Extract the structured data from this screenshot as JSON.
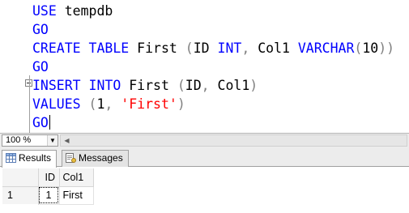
{
  "editor": {
    "lines": [
      {
        "parts": [
          {
            "t": "USE ",
            "c": "kw"
          },
          {
            "t": "tempdb",
            "c": "ident"
          }
        ]
      },
      {
        "parts": [
          {
            "t": "GO",
            "c": "kw"
          }
        ]
      },
      {
        "parts": [
          {
            "t": "CREATE ",
            "c": "kw"
          },
          {
            "t": "TABLE ",
            "c": "kw"
          },
          {
            "t": "First ",
            "c": "ident"
          },
          {
            "t": "(",
            "c": "punct"
          },
          {
            "t": "ID ",
            "c": "ident"
          },
          {
            "t": "INT",
            "c": "kw"
          },
          {
            "t": ", ",
            "c": "punct"
          },
          {
            "t": "Col1 ",
            "c": "ident"
          },
          {
            "t": "VARCHAR",
            "c": "kw"
          },
          {
            "t": "(",
            "c": "punct"
          },
          {
            "t": "10",
            "c": "num"
          },
          {
            "t": "))",
            "c": "punct"
          }
        ]
      },
      {
        "parts": [
          {
            "t": "GO",
            "c": "kw"
          }
        ]
      },
      {
        "parts": [
          {
            "t": "INSERT ",
            "c": "kw"
          },
          {
            "t": "INTO ",
            "c": "kw"
          },
          {
            "t": "First ",
            "c": "ident"
          },
          {
            "t": "(",
            "c": "punct"
          },
          {
            "t": "ID",
            "c": "ident"
          },
          {
            "t": ", ",
            "c": "punct"
          },
          {
            "t": "Col1",
            "c": "ident"
          },
          {
            "t": ")",
            "c": "punct"
          }
        ]
      },
      {
        "parts": [
          {
            "t": "VALUES ",
            "c": "kw"
          },
          {
            "t": "(",
            "c": "punct"
          },
          {
            "t": "1",
            "c": "num"
          },
          {
            "t": ", ",
            "c": "punct"
          },
          {
            "t": "'First'",
            "c": "str"
          },
          {
            "t": ")",
            "c": "punct"
          }
        ]
      },
      {
        "parts": [
          {
            "t": "GO",
            "c": "kw"
          }
        ],
        "caret": true
      }
    ],
    "colors": {
      "keyword": "#0000ff",
      "string": "#ff0000",
      "punct": "#808080"
    }
  },
  "zoom": {
    "value": "100 %",
    "arrow_icon": "chevron-down-icon"
  },
  "results_tabs": [
    {
      "label": "Results",
      "icon": "grid-icon",
      "active": true
    },
    {
      "label": "Messages",
      "icon": "messages-icon",
      "active": false
    }
  ],
  "grid": {
    "columns": [
      "ID",
      "Col1"
    ],
    "rows": [
      {
        "rownum": "1",
        "cells": [
          "1",
          "First"
        ]
      }
    ]
  }
}
